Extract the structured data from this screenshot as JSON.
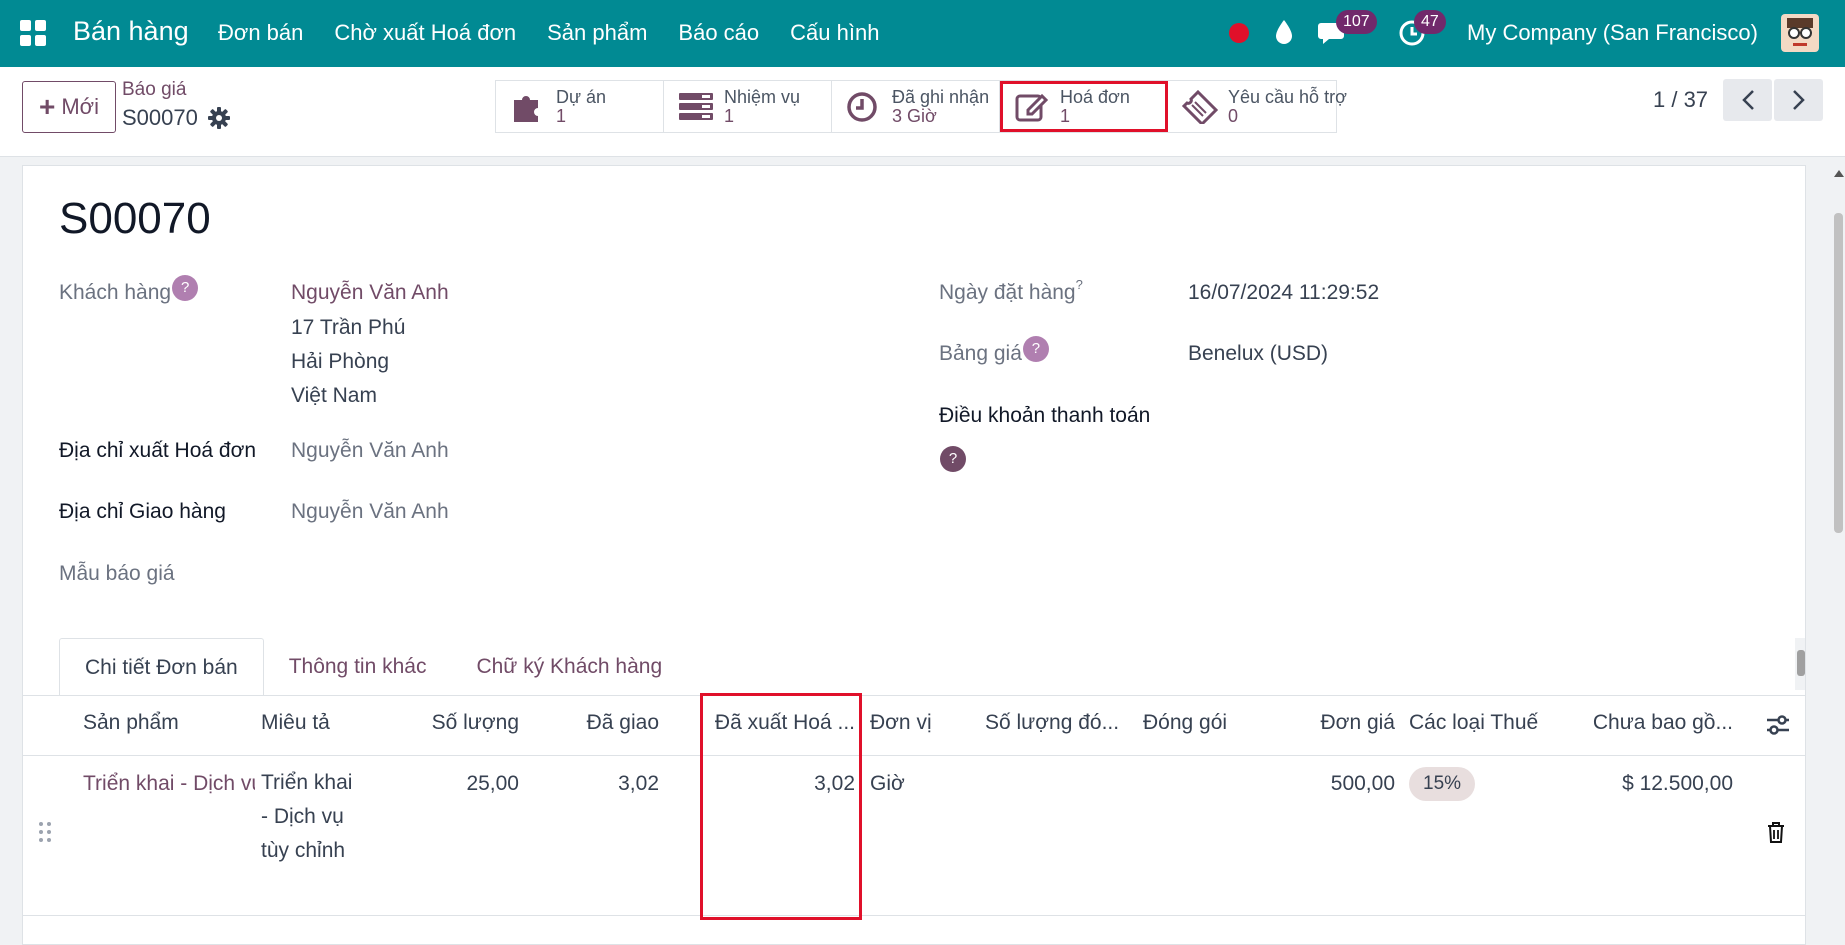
{
  "navbar": {
    "brand": "Bán hàng",
    "menu": [
      "Đơn bán",
      "Chờ xuất Hoá đơn",
      "Sản phẩm",
      "Báo cáo",
      "Cấu hình"
    ],
    "chat_count": "107",
    "activity_count": "47",
    "company": "My Company (San Francisco)",
    "colors": {
      "bar": "#018a93",
      "badge": "#71296b",
      "record": "#e0102a"
    }
  },
  "control": {
    "new_label": "Mới",
    "breadcrumb": "Báo giá",
    "record_name": "S00070",
    "smart_buttons": [
      {
        "label": "Dự án",
        "value": "1",
        "icon": "puzzle-icon"
      },
      {
        "label": "Nhiệm vụ",
        "value": "1",
        "icon": "tasks-icon"
      },
      {
        "label": "Đã ghi nhận",
        "value": "3 Giờ",
        "icon": "clock-icon"
      },
      {
        "label": "Hoá đơn",
        "value": "1",
        "icon": "invoice-edit-icon"
      },
      {
        "label": "Yêu cầu hỗ trợ",
        "value": "0",
        "icon": "ticket-icon"
      }
    ],
    "pager": "1 / 37"
  },
  "form": {
    "title": "S00070",
    "customer_label": "Khách hàng",
    "customer_name": "Nguyễn Văn Anh",
    "customer_address": [
      "17 Trần Phú",
      "Hải Phòng",
      "Việt Nam"
    ],
    "invoice_address_label": "Địa chỉ xuất Hoá đơn",
    "invoice_address_value": "Nguyễn Văn Anh",
    "delivery_address_label": "Địa chỉ Giao hàng",
    "delivery_address_value": "Nguyễn Văn Anh",
    "quotation_template_label": "Mẫu báo giá",
    "order_date_label": "Ngày đặt hàng",
    "order_date_value": "16/07/2024 11:29:52",
    "pricelist_label": "Bảng giá",
    "pricelist_value": "Benelux (USD)",
    "payment_terms_label": "Điều khoản thanh toán",
    "help_mark": "?"
  },
  "tabs": [
    "Chi tiết Đơn bán",
    "Thông tin khác",
    "Chữ ký Khách hàng"
  ],
  "table": {
    "headers": [
      "Sản phẩm",
      "Miêu tả",
      "Số lượng",
      "Đã giao",
      "Đã xuất Hoá ...",
      "Đơn vị",
      "Số lượng đó...",
      "Đóng gói",
      "Đơn giá",
      "Các loại Thuế",
      "Chưa bao gồ..."
    ],
    "rows": [
      {
        "product": "Triển khai - Dịch vụ tùy chỉnh",
        "description": "Triển khai - Dịch vụ tùy chỉnh",
        "quantity": "25,00",
        "delivered": "3,02",
        "invoiced": "3,02",
        "uom": "Giờ",
        "packaging_qty": "",
        "packaging": "",
        "unit_price": "500,00",
        "taxes": "15%",
        "subtotal": "$ 12.500,00"
      }
    ]
  }
}
